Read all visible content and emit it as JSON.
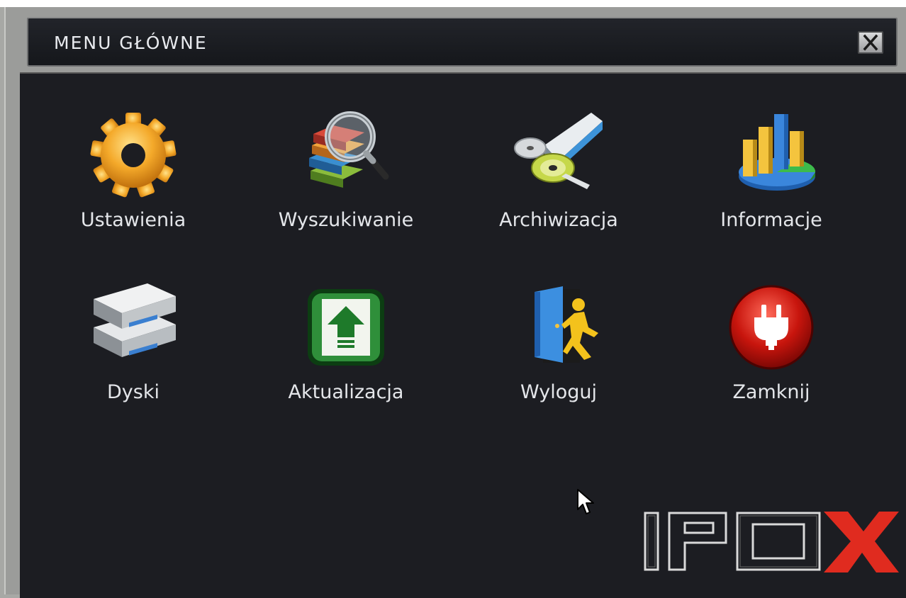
{
  "window": {
    "title": "MENU GŁÓWNE"
  },
  "menu": {
    "items": [
      {
        "label": "Ustawienia",
        "icon": "gear-icon"
      },
      {
        "label": "Wyszukiwanie",
        "icon": "magnifier-books-icon"
      },
      {
        "label": "Archiwizacja",
        "icon": "disc-drive-icon"
      },
      {
        "label": "Informacje",
        "icon": "chart-icon"
      },
      {
        "label": "Dyski",
        "icon": "hard-disks-icon"
      },
      {
        "label": "Aktualizacja",
        "icon": "upgrade-arrow-icon"
      },
      {
        "label": "Wyloguj",
        "icon": "logout-door-icon"
      },
      {
        "label": "Zamknij",
        "icon": "power-plug-icon"
      }
    ]
  },
  "brand": {
    "logo_text": "IPOX",
    "accent_color": "#e02b1f"
  },
  "colors": {
    "panel_bg": "#1c1d22",
    "titlebar_bg": "#1b1d21",
    "text": "#e4e6ea"
  }
}
